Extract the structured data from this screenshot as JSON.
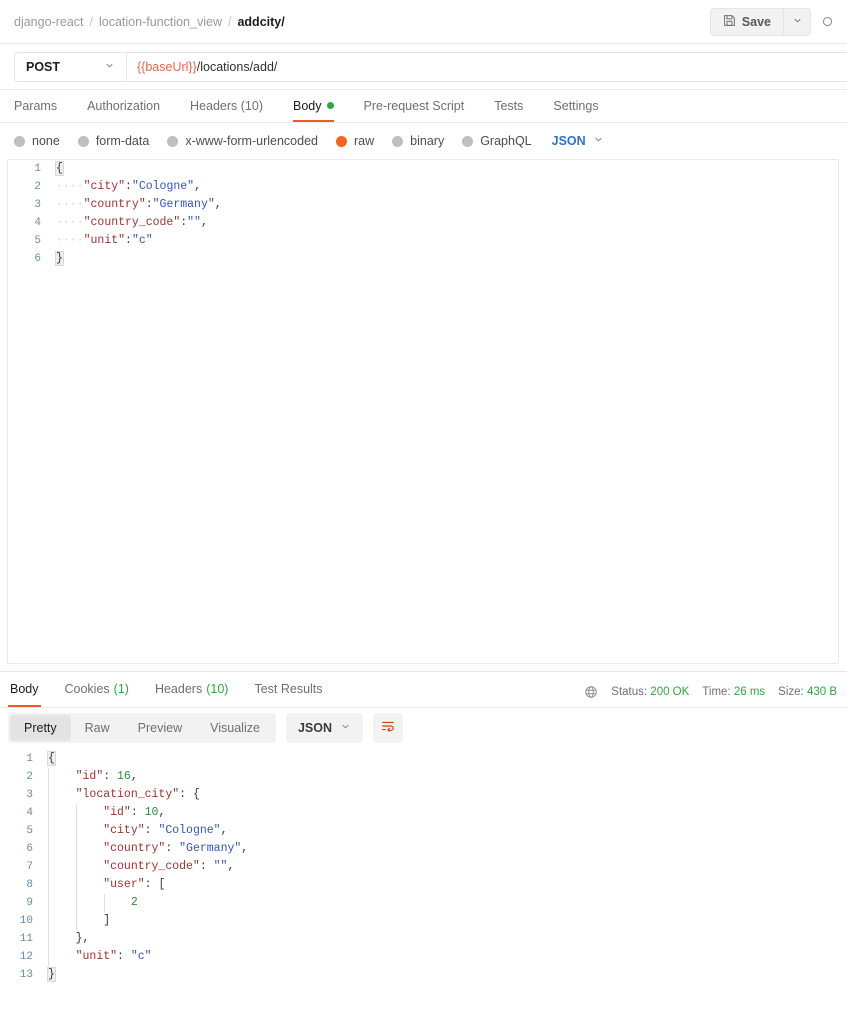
{
  "topbar": {
    "breadcrumb": [
      "django-react",
      "location-function_view",
      "addcity/"
    ],
    "separator": "/",
    "save_label": "Save",
    "save_icon": "floppy-disk-icon",
    "caret_icon": "chevron-down-icon"
  },
  "request": {
    "method": "POST",
    "url_variable": "{{baseUrl}}",
    "url_path": "/locations/add/",
    "tabs": [
      {
        "label": "Params",
        "active": false,
        "dot": false
      },
      {
        "label": "Authorization",
        "active": false,
        "dot": false
      },
      {
        "label": "Headers (10)",
        "active": false,
        "dot": false
      },
      {
        "label": "Body",
        "active": true,
        "dot": true
      },
      {
        "label": "Pre-request Script",
        "active": false,
        "dot": false
      },
      {
        "label": "Tests",
        "active": false,
        "dot": false
      },
      {
        "label": "Settings",
        "active": false,
        "dot": false
      }
    ],
    "body_types": [
      {
        "label": "none",
        "selected": false
      },
      {
        "label": "form-data",
        "selected": false
      },
      {
        "label": "x-www-form-urlencoded",
        "selected": false
      },
      {
        "label": "raw",
        "selected": true
      },
      {
        "label": "binary",
        "selected": false
      },
      {
        "label": "GraphQL",
        "selected": false
      }
    ],
    "format_select": "JSON",
    "body_lines": [
      {
        "n": "1",
        "indent": 0,
        "tokens": [
          {
            "t": "{",
            "c": "brace"
          }
        ]
      },
      {
        "n": "2",
        "indent": 1,
        "tokens": [
          {
            "t": "\"city\"",
            "c": "k"
          },
          {
            "t": ":",
            "c": "p"
          },
          {
            "t": "\"Cologne\"",
            "c": "s"
          },
          {
            "t": ",",
            "c": "p"
          }
        ]
      },
      {
        "n": "3",
        "indent": 1,
        "tokens": [
          {
            "t": "\"country\"",
            "c": "k"
          },
          {
            "t": ":",
            "c": "p"
          },
          {
            "t": "\"Germany\"",
            "c": "s"
          },
          {
            "t": ",",
            "c": "p"
          }
        ]
      },
      {
        "n": "4",
        "indent": 1,
        "tokens": [
          {
            "t": "\"country_code\"",
            "c": "k"
          },
          {
            "t": ":",
            "c": "p"
          },
          {
            "t": "\"\"",
            "c": "s"
          },
          {
            "t": ",",
            "c": "p"
          }
        ]
      },
      {
        "n": "5",
        "indent": 1,
        "tokens": [
          {
            "t": "\"unit\"",
            "c": "k"
          },
          {
            "t": ":",
            "c": "p"
          },
          {
            "t": "\"c\"",
            "c": "s"
          }
        ]
      },
      {
        "n": "6",
        "indent": 0,
        "tokens": [
          {
            "t": "}",
            "c": "brace"
          }
        ]
      }
    ]
  },
  "response": {
    "tabs": [
      {
        "label": "Body",
        "count": "",
        "active": true
      },
      {
        "label": "Cookies",
        "count": "(1)",
        "active": false
      },
      {
        "label": "Headers",
        "count": "(10)",
        "active": false
      },
      {
        "label": "Test Results",
        "count": "",
        "active": false
      }
    ],
    "globe_icon": "globe-icon",
    "meta": [
      {
        "label": "Status:",
        "value": "200 OK"
      },
      {
        "label": "Time:",
        "value": "26 ms"
      },
      {
        "label": "Size:",
        "value": "430 B"
      }
    ],
    "view_modes": [
      {
        "label": "Pretty",
        "active": true
      },
      {
        "label": "Raw",
        "active": false
      },
      {
        "label": "Preview",
        "active": false
      },
      {
        "label": "Visualize",
        "active": false
      }
    ],
    "format_select": "JSON",
    "wrap_icon": "word-wrap-icon",
    "body_lines": [
      {
        "n": "1",
        "pad": 0,
        "text": "{",
        "brace": true
      },
      {
        "n": "2",
        "pad": 1,
        "tokens": [
          {
            "t": "\"id\"",
            "c": "k"
          },
          {
            "t": ": ",
            "c": "p"
          },
          {
            "t": "16",
            "c": "n"
          },
          {
            "t": ",",
            "c": "p"
          }
        ]
      },
      {
        "n": "3",
        "pad": 1,
        "tokens": [
          {
            "t": "\"location_city\"",
            "c": "k"
          },
          {
            "t": ": ",
            "c": "p"
          },
          {
            "t": "{",
            "c": "p"
          }
        ]
      },
      {
        "n": "4",
        "pad": 2,
        "tokens": [
          {
            "t": "\"id\"",
            "c": "k"
          },
          {
            "t": ": ",
            "c": "p"
          },
          {
            "t": "10",
            "c": "n"
          },
          {
            "t": ",",
            "c": "p"
          }
        ]
      },
      {
        "n": "5",
        "pad": 2,
        "tokens": [
          {
            "t": "\"city\"",
            "c": "k"
          },
          {
            "t": ": ",
            "c": "p"
          },
          {
            "t": "\"Cologne\"",
            "c": "s"
          },
          {
            "t": ",",
            "c": "p"
          }
        ]
      },
      {
        "n": "6",
        "pad": 2,
        "tokens": [
          {
            "t": "\"country\"",
            "c": "k"
          },
          {
            "t": ": ",
            "c": "p"
          },
          {
            "t": "\"Germany\"",
            "c": "s"
          },
          {
            "t": ",",
            "c": "p"
          }
        ]
      },
      {
        "n": "7",
        "pad": 2,
        "tokens": [
          {
            "t": "\"country_code\"",
            "c": "k"
          },
          {
            "t": ": ",
            "c": "p"
          },
          {
            "t": "\"\"",
            "c": "s"
          },
          {
            "t": ",",
            "c": "p"
          }
        ]
      },
      {
        "n": "8",
        "pad": 2,
        "tokens": [
          {
            "t": "\"user\"",
            "c": "k"
          },
          {
            "t": ": ",
            "c": "p"
          },
          {
            "t": "[",
            "c": "p"
          }
        ]
      },
      {
        "n": "9",
        "pad": 3,
        "tokens": [
          {
            "t": "2",
            "c": "n"
          }
        ]
      },
      {
        "n": "10",
        "pad": 2,
        "tokens": [
          {
            "t": "]",
            "c": "p"
          }
        ]
      },
      {
        "n": "11",
        "pad": 1,
        "tokens": [
          {
            "t": "}",
            "c": "p"
          },
          {
            "t": ",",
            "c": "p"
          }
        ]
      },
      {
        "n": "12",
        "pad": 1,
        "tokens": [
          {
            "t": "\"unit\"",
            "c": "k"
          },
          {
            "t": ": ",
            "c": "p"
          },
          {
            "t": "\"c\"",
            "c": "s"
          }
        ]
      },
      {
        "n": "13",
        "pad": 0,
        "text": "}",
        "brace": true
      }
    ]
  },
  "colors": {
    "accent": "#ef5b25",
    "success": "#2fa83f",
    "variable": "#f0654a",
    "link": "#2f6fd0",
    "key": "#a03232",
    "string": "#3355bb",
    "number": "#2f8a3e"
  }
}
